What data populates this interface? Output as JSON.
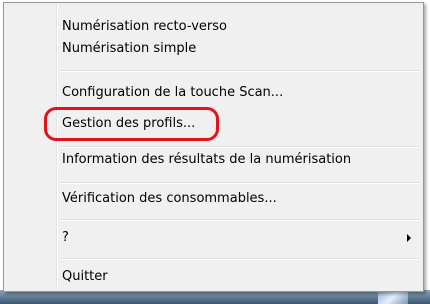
{
  "menu": {
    "items": [
      {
        "label": "Numérisation recto-verso"
      },
      {
        "label": "Numérisation simple"
      },
      {
        "label": "Configuration de la touche Scan..."
      },
      {
        "label": "Gestion des profils..."
      },
      {
        "label": "Information des résultats de la numérisation"
      },
      {
        "label": "Vérification des consommables..."
      },
      {
        "label": "?"
      },
      {
        "label": "Quitter"
      }
    ]
  },
  "highlight_color": "#e0141b",
  "submenu_arrow_icon": "chevron-right-icon"
}
